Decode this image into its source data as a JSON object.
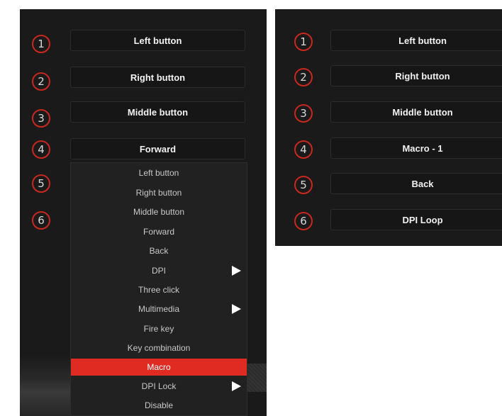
{
  "left_panel": {
    "numbers": [
      "1",
      "2",
      "3",
      "4",
      "5",
      "6"
    ],
    "buttons": [
      "Left button",
      "Right button",
      "Middle button",
      "Forward"
    ],
    "dropdown": [
      {
        "label": "Left button",
        "submenu": false,
        "selected": false
      },
      {
        "label": "Right button",
        "submenu": false,
        "selected": false
      },
      {
        "label": "Middle button",
        "submenu": false,
        "selected": false
      },
      {
        "label": "Forward",
        "submenu": false,
        "selected": false
      },
      {
        "label": "Back",
        "submenu": false,
        "selected": false
      },
      {
        "label": "DPI",
        "submenu": true,
        "selected": false
      },
      {
        "label": "Three click",
        "submenu": false,
        "selected": false
      },
      {
        "label": "Multimedia",
        "submenu": true,
        "selected": false
      },
      {
        "label": "Fire key",
        "submenu": false,
        "selected": false
      },
      {
        "label": "Key combination",
        "submenu": false,
        "selected": false
      },
      {
        "label": "Macro",
        "submenu": false,
        "selected": true
      },
      {
        "label": "DPI Lock",
        "submenu": true,
        "selected": false
      },
      {
        "label": "Disable",
        "submenu": false,
        "selected": false
      }
    ]
  },
  "right_panel": {
    "numbers": [
      "1",
      "2",
      "3",
      "4",
      "5",
      "6"
    ],
    "buttons": [
      "Left button",
      "Right button",
      "Middle button",
      "Macro - 1",
      "Back",
      "DPI Loop"
    ]
  },
  "colors": {
    "panel_bg": "#1a1a1a",
    "accent_red": "#e02b22",
    "circle_red": "#c8281e"
  }
}
